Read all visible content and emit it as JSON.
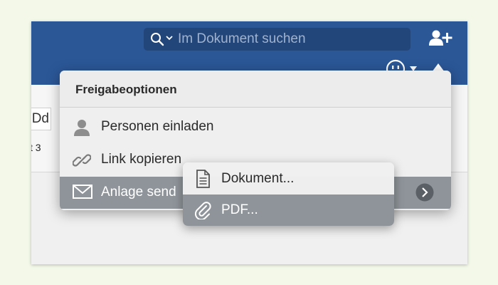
{
  "search": {
    "placeholder": "Im Dokument suchen"
  },
  "ribbon": {
    "swatch_text": "Dd",
    "fragment_text": "t 3"
  },
  "share_menu": {
    "title": "Freigabeoptionen",
    "items": [
      {
        "label": "Personen einladen",
        "icon": "person-icon"
      },
      {
        "label": "Link kopieren",
        "icon": "link-icon"
      },
      {
        "label": "Anlage send",
        "icon": "envelope-icon"
      }
    ]
  },
  "submenu": {
    "items": [
      {
        "label": "Dokument...",
        "icon": "document-icon"
      },
      {
        "label": "PDF...",
        "icon": "paperclip-icon"
      }
    ]
  },
  "colors": {
    "title_bar": "#2b5797",
    "search_field": "#224679",
    "selected_item": "#8e9499",
    "page_background": "#f3f8e8"
  }
}
